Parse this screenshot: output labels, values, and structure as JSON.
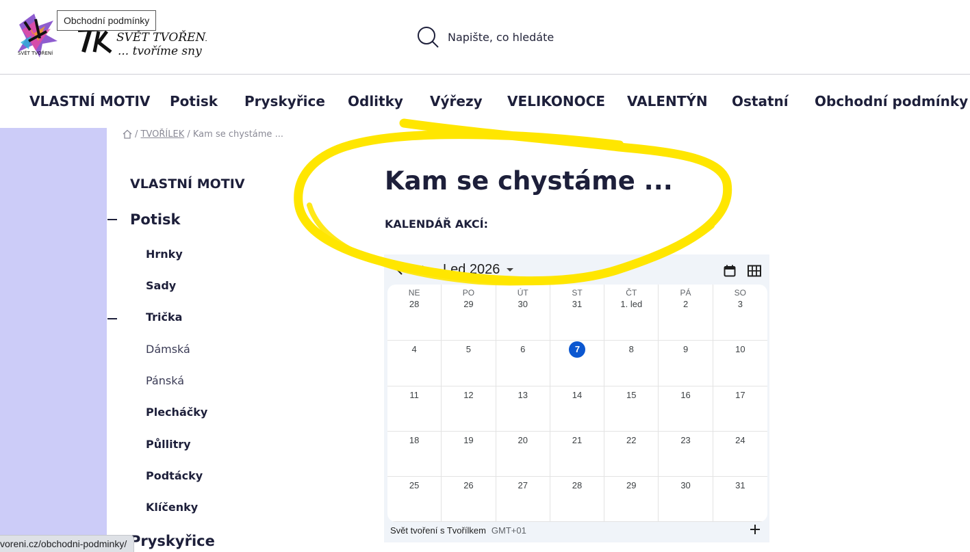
{
  "header": {
    "tooltip": "Obchodní podmínky",
    "logo_text": "SVĚT TVOŘENÍ",
    "logo_tagline": "... tvoříme sny",
    "logo_small": "SVĚT TVOŘENÍ",
    "search_placeholder": "Napište, co hledáte"
  },
  "nav": [
    "VLASTNÍ MOTIV",
    "Potisk",
    "Pryskyřice",
    "Odlitky",
    "Výřezy",
    "VELIKONOCE",
    "VALENTÝN",
    "Ostatní",
    "Obchodní podmínky"
  ],
  "breadcrumb": {
    "sep1": "/",
    "link": "TVOŘÍLEK",
    "sep2": "/",
    "current": "Kam se chystáme ..."
  },
  "sidebar": {
    "vlastni_motiv": "VLASTNÍ MOTIV",
    "potisk": "Potisk",
    "hrnky": "Hrnky",
    "sady": "Sady",
    "tricka": "Trička",
    "damska": "Dámská",
    "panska": "Pánská",
    "plechacky": "Plecháčky",
    "pullitry": "Půllitry",
    "podtacky": "Podtácky",
    "klicenky": "Klíčenky",
    "pryskyrice": "Pryskyřice"
  },
  "content": {
    "title": "Kam se chystáme ...",
    "subheading": "KALENDÁŘ AKCÍ:"
  },
  "calendar": {
    "month_label": "Led 2026",
    "weekdays": [
      "NE",
      "PO",
      "ÚT",
      "ST",
      "ČT",
      "PÁ",
      "SO"
    ],
    "weeks": [
      [
        "28",
        "29",
        "30",
        "31",
        "1. led",
        "2",
        "3"
      ],
      [
        "4",
        "5",
        "6",
        "7",
        "8",
        "9",
        "10"
      ],
      [
        "11",
        "12",
        "13",
        "14",
        "15",
        "16",
        "17"
      ],
      [
        "18",
        "19",
        "20",
        "21",
        "22",
        "23",
        "24"
      ],
      [
        "25",
        "26",
        "27",
        "28",
        "29",
        "30",
        "31"
      ]
    ],
    "today": "7",
    "calendar_name": "Svět tvoření s Tvořílkem",
    "timezone": "GMT+01",
    "today_color": "#0b57d0"
  },
  "statusbar": {
    "url": "voreni.cz/obchodni-podminky/"
  },
  "colors": {
    "text": "#1d1f3a",
    "left_band": "#ccccf8",
    "highlight": "#ffe600"
  }
}
